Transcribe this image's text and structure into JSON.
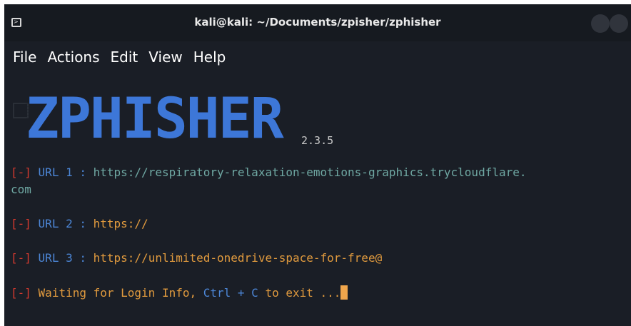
{
  "window": {
    "title": "kali@kali: ~/Documents/zpisher/zphisher"
  },
  "menu": {
    "items": [
      "File",
      "Actions",
      "Edit",
      "View",
      "Help"
    ]
  },
  "banner": {
    "logo": "ZPHISHER",
    "version": "2.3.5"
  },
  "lines": {
    "url1": {
      "bracket": "[-]",
      "label": "URL 1 :",
      "value_part1": "https://respiratory-relaxation-emotions-graphics.trycloudflare.",
      "value_part2": "com"
    },
    "url2": {
      "bracket": "[-]",
      "label": "URL 2 :",
      "value": "https://"
    },
    "url3": {
      "bracket": "[-]",
      "label": "URL 3 :",
      "value": "https://unlimited-onedrive-space-for-free@"
    },
    "status": {
      "bracket": "[-]",
      "text_before": "Waiting for Login Info,",
      "shortcut": "Ctrl + C",
      "text_after": "to exit ..."
    }
  },
  "colors": {
    "background": "#1a1e26",
    "bracket": "#d43a2f",
    "label": "#4c86d6",
    "value": "#e09a3e",
    "logo": "#3d77d8",
    "cursor": "#f0a64c"
  },
  "icons": [
    "terminal-icon",
    "minimize-button",
    "maximize-button"
  ]
}
